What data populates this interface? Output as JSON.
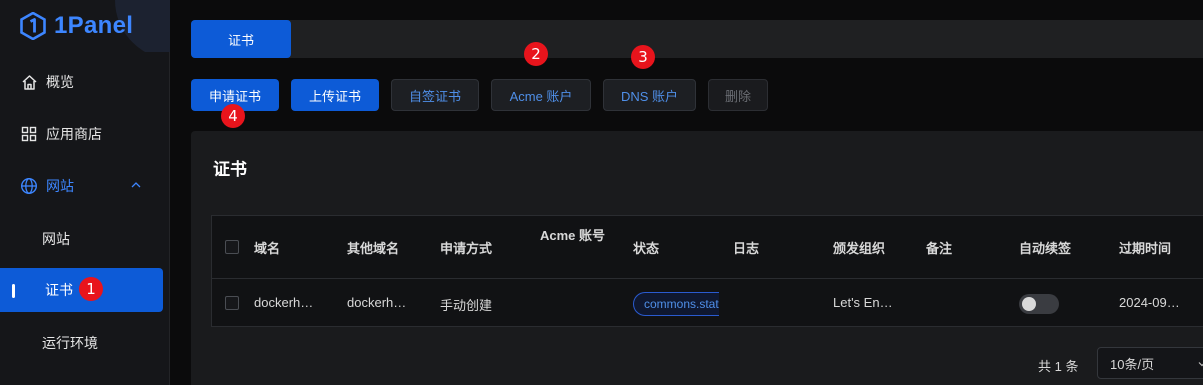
{
  "app": {
    "logo_text": "1Panel"
  },
  "sidebar": {
    "items": [
      {
        "label": "概览",
        "icon": "home-icon"
      },
      {
        "label": "应用商店",
        "icon": "grid-icon"
      },
      {
        "label": "网站",
        "icon": "globe-icon",
        "expanded": true
      },
      {
        "label": "网站",
        "sub": true
      },
      {
        "label": "证书",
        "sub": true,
        "selected": true
      },
      {
        "label": "运行环境",
        "sub": true
      }
    ]
  },
  "tabs": [
    {
      "label": "证书"
    }
  ],
  "toolbar": {
    "apply_label": "申请证书",
    "upload_label": "上传证书",
    "self_sign_label": "自签证书",
    "acme_label": "Acme 账户",
    "dns_label": "DNS 账户",
    "delete_label": "删除"
  },
  "card": {
    "title": "证书"
  },
  "table": {
    "columns": [
      "域名",
      "其他域名",
      "申请方式",
      "Acme 账号",
      "状态",
      "日志",
      "颁发组织",
      "备注",
      "自动续签",
      "过期时间"
    ],
    "rows": [
      {
        "domain": "dockerh…",
        "other_domains": "dockerh…",
        "method": "手动创建",
        "acme_account": "",
        "status": "commons.status",
        "log": "",
        "issuer": "Let's En…",
        "remark": "",
        "auto_renew": false,
        "expire": "2024-09…"
      }
    ]
  },
  "pagination": {
    "total": "共 1 条",
    "page_size": "10条/页"
  },
  "annotations": [
    "1",
    "2",
    "3",
    "4"
  ],
  "colors": {
    "primary": "#0d5bd7",
    "accent": "#3d86ff",
    "badge": "#e8141c"
  }
}
